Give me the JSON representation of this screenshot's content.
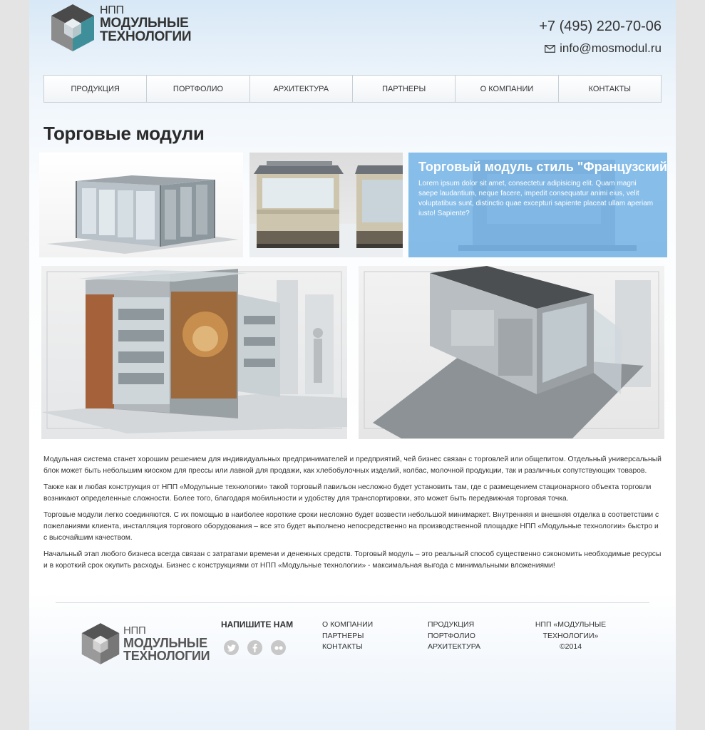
{
  "header": {
    "logo": {
      "line1": "НПП",
      "line2": "МОДУЛЬНЫЕ",
      "line3": "ТЕХНОЛОГИИ"
    },
    "phone": "+7 (495) 220-70-06",
    "email": "info@mosmodul.ru"
  },
  "nav": {
    "items": [
      "ПРОДУКЦИЯ",
      "ПОРТФОЛИО",
      "АРХИТЕКТУРА",
      "ПАРТНЕРЫ",
      "О КОМПАНИИ",
      "КОНТАКТЫ"
    ]
  },
  "main": {
    "title": "Торговые модули",
    "gallery": {
      "overlay_title": "Торговый модуль стиль \"Французский\"",
      "overlay_text": "Lorem ipsum dolor sit amet, consectetur adipisicing elit. Quam magni saepe laudantium, neque facere, impedit consequatur animi eius, velit voluptatibus sunt, distinctio quae excepturi sapiente placeat ullam aperiam iusto! Sapiente?"
    },
    "paragraphs": [
      "Модульная система станет хорошим решением для индивидуальных предпринимателей и предприятий, чей бизнес связан с торговлей или общепитом. Отдельный универсальный блок может быть небольшим киоском для прессы или лавкой для продажи, как хлебобулочных изделий, колбас, молочной продукции, так и различных сопутствующих товаров.",
      "Также как и любая конструкция от НПП «Модульные технологии» такой торговый павильон несложно будет установить там, где с размещением стационарного объекта торговли возникают определенные сложности. Более того, благодаря мобильности и удобству для транспортировки, это может быть передвижная торговая точка.",
      "Торговые модули легко соединяются. С их помощью в наиболее короткие сроки несложно будет возвести небольшой минимаркет. Внутренняя и внешняя отделка в соответствии с пожеланиями клиента, инсталляция торгового оборудования – все это будет выполнено непосредственно на производственной площадке НПП «Модульные технологии» быстро и с высочайшим качеством.",
      "Начальный этап любого бизнеса всегда связан с затратами времени и денежных средств. Торговый модуль – это реальный способ существенно сэкономить необходимые ресурсы и в короткий срок окупить расходы. Бизнес с конструкциями от НПП «Модульные технологии» - максимальная выгода с минимальными вложениями!"
    ]
  },
  "footer": {
    "logo": {
      "line1": "НПП",
      "line2": "МОДУЛЬНЫЕ",
      "line3": "ТЕХНОЛОГИИ"
    },
    "write_us": "НАПИШИТЕ НАМ",
    "social_icons": [
      "twitter-icon",
      "facebook-icon",
      "flickr-icon"
    ],
    "links_col1": [
      "О КОМПАНИИ",
      "ПАРТНЕРЫ",
      "КОНТАКТЫ"
    ],
    "links_col2": [
      "ПРОДУКЦИЯ",
      "ПОРТФОЛИО",
      "АРХИТЕКТУРА"
    ],
    "company": "НПП «МОДУЛЬНЫЕ ТЕХНОЛОГИИ»",
    "year": "©2014"
  },
  "colors": {
    "overlay": "#70b2e8",
    "logo_top": "#4a4a4a",
    "logo_left": "#8c8c8c",
    "logo_right": "#3e8f9a"
  }
}
